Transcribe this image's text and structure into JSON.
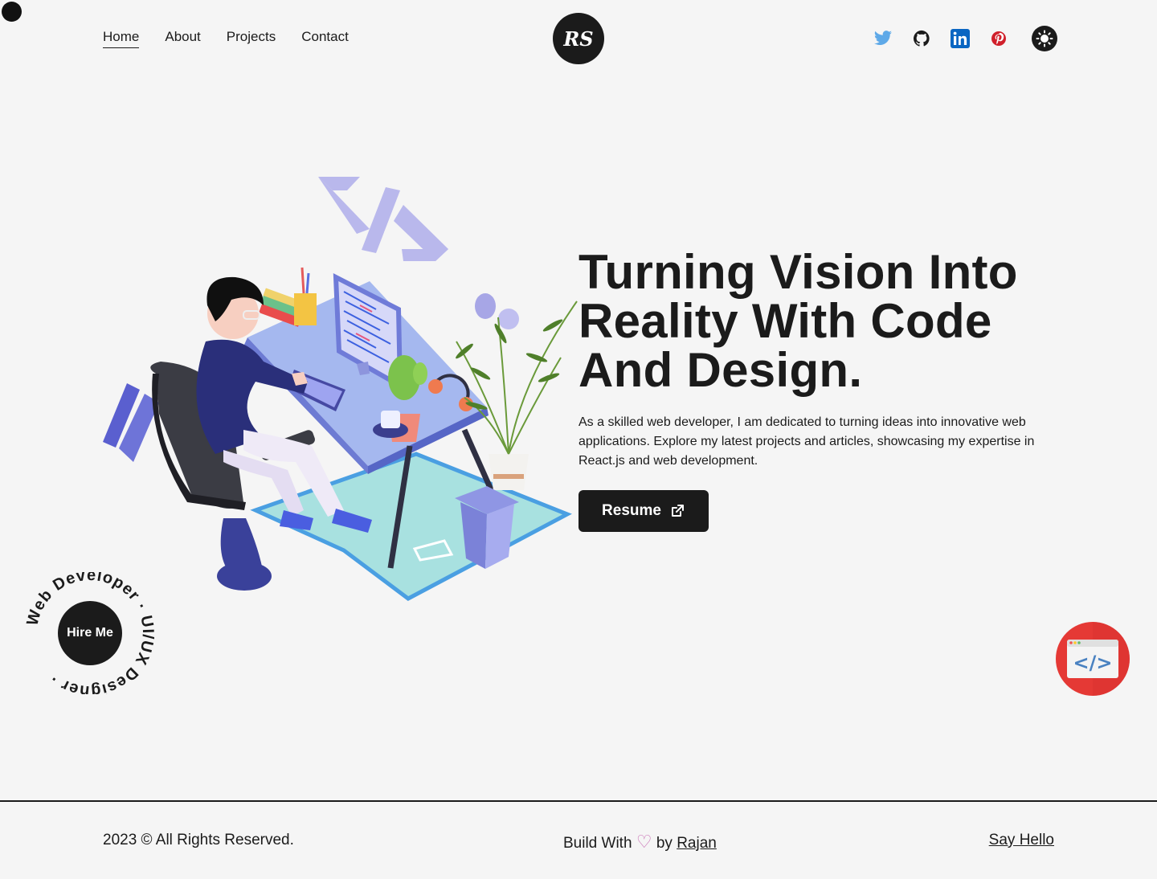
{
  "nav": {
    "items": [
      {
        "label": "Home",
        "active": true
      },
      {
        "label": "About"
      },
      {
        "label": "Projects"
      },
      {
        "label": "Contact"
      }
    ]
  },
  "logo": {
    "text": "RS"
  },
  "socials": {
    "icons": [
      "twitter-icon",
      "github-icon",
      "linkedin-icon",
      "pinterest-icon",
      "sun-icon"
    ],
    "colors": {
      "twitter": "#1da1f2",
      "github": "#1b1b1b",
      "linkedin": "#0a66c2",
      "pinterest": "#e60023"
    }
  },
  "hero": {
    "headline": "Turning Vision Into Reality With Code And Design.",
    "intro": "As a skilled web developer, I am dedicated to turning ideas into innovative web applications. Explore my latest projects and articles, showcasing my expertise in React.js and web development.",
    "resume_label": "Resume",
    "illustration": {
      "code_symbol": "</>"
    }
  },
  "hire": {
    "button_label": "Hire Me",
    "ring_text": "Web Developer · UI/UX Designer ·"
  },
  "code_badge": {
    "symbol": "</>"
  },
  "footer": {
    "copyright": "2023 © All Rights Reserved.",
    "build_prefix": "Build With",
    "heart": "♡",
    "build_by": "by",
    "author_link": "Rajan",
    "say_hello": "Say Hello"
  },
  "colors": {
    "background": "#f5f5f5",
    "dark": "#1b1b1b",
    "heart": "#c86fb4",
    "badge": "#e53935"
  }
}
